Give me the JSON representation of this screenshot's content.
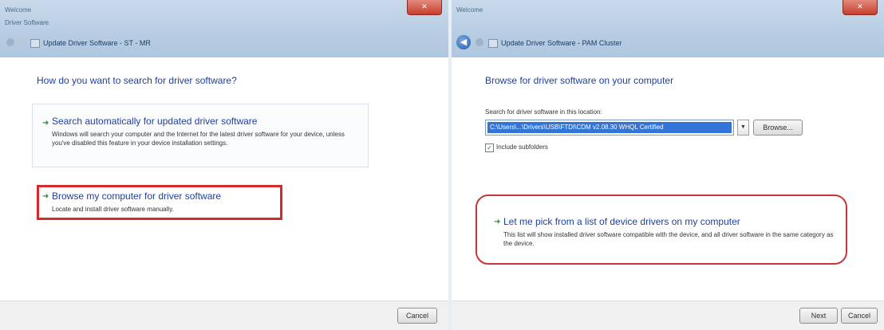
{
  "left_window": {
    "title": "Welcome",
    "subtitle": "Driver Software",
    "breadcrumb": "Update Driver Software - ST - MR",
    "question": "How do you want to search for driver software?",
    "options": [
      {
        "title": "Search automatically for updated driver software",
        "description": "Windows will search your computer and the Internet for the latest driver software for your device, unless you've disabled this feature in your device installation settings."
      },
      {
        "title": "Browse my computer for driver software",
        "description": "Locate and install driver software manually."
      }
    ],
    "cancel_label": "Cancel"
  },
  "right_window": {
    "title": "Welcome",
    "breadcrumb": "Update Driver Software - PAM Cluster",
    "heading": "Browse for driver software on your computer",
    "search_label": "Search for driver software in this location:",
    "path_value": "C:\\Users\\...\\Drivers\\USB\\FTDI\\CDM v2.08.30 WHQL Certified",
    "browse_label": "Browse...",
    "include_subfolders_label": "Include subfolders",
    "include_subfolders_checked": true,
    "pick_option": {
      "title": "Let me pick from a list of device drivers on my computer",
      "description": "This list will show installed driver software compatible with the device, and all driver software in the same category as the device."
    },
    "next_label": "Next",
    "cancel_label": "Cancel"
  },
  "colors": {
    "accent_blue": "#1f3f9a",
    "highlight_red": "#d52b2b",
    "arrow_green": "#2e8b3a",
    "selection_blue": "#3375d6"
  }
}
